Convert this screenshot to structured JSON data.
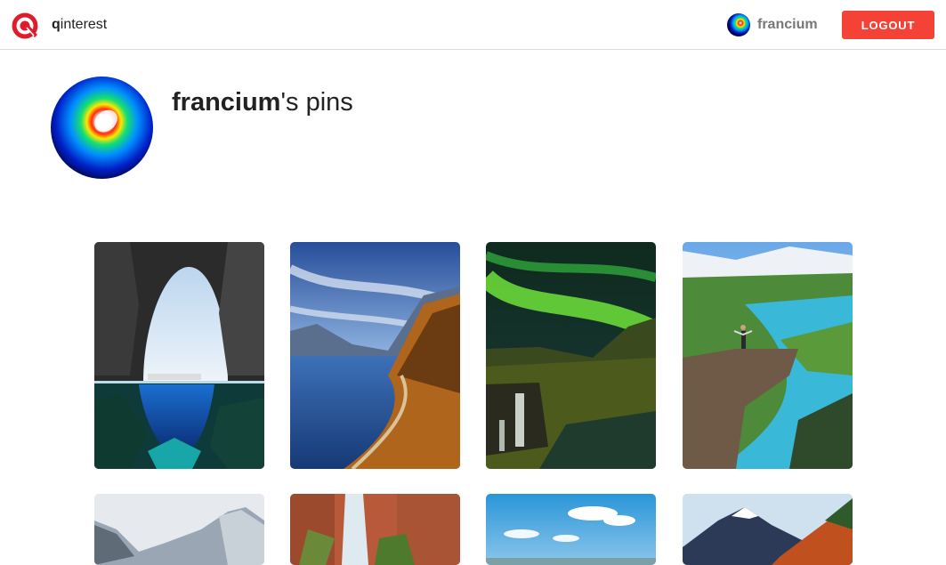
{
  "app": {
    "brand_bold": "q",
    "brand_rest": "interest"
  },
  "header": {
    "username": "francium",
    "logout_label": "LOGOUT"
  },
  "profile": {
    "username": "francium",
    "title_suffix": "'s pins"
  },
  "colors": {
    "accent": "#f44336",
    "logo_red": "#e01b2b",
    "muted_text": "#777777"
  },
  "pins": [
    {
      "name": "pin-sea-cave-diver"
    },
    {
      "name": "pin-mountain-lake-road"
    },
    {
      "name": "pin-aurora-waterfall"
    },
    {
      "name": "pin-cliff-fjord-hiker"
    },
    {
      "name": "pin-snowy-mountains"
    },
    {
      "name": "pin-canyon-waterfall"
    },
    {
      "name": "pin-blue-sky-clouds"
    },
    {
      "name": "pin-autumn-mountain"
    }
  ]
}
